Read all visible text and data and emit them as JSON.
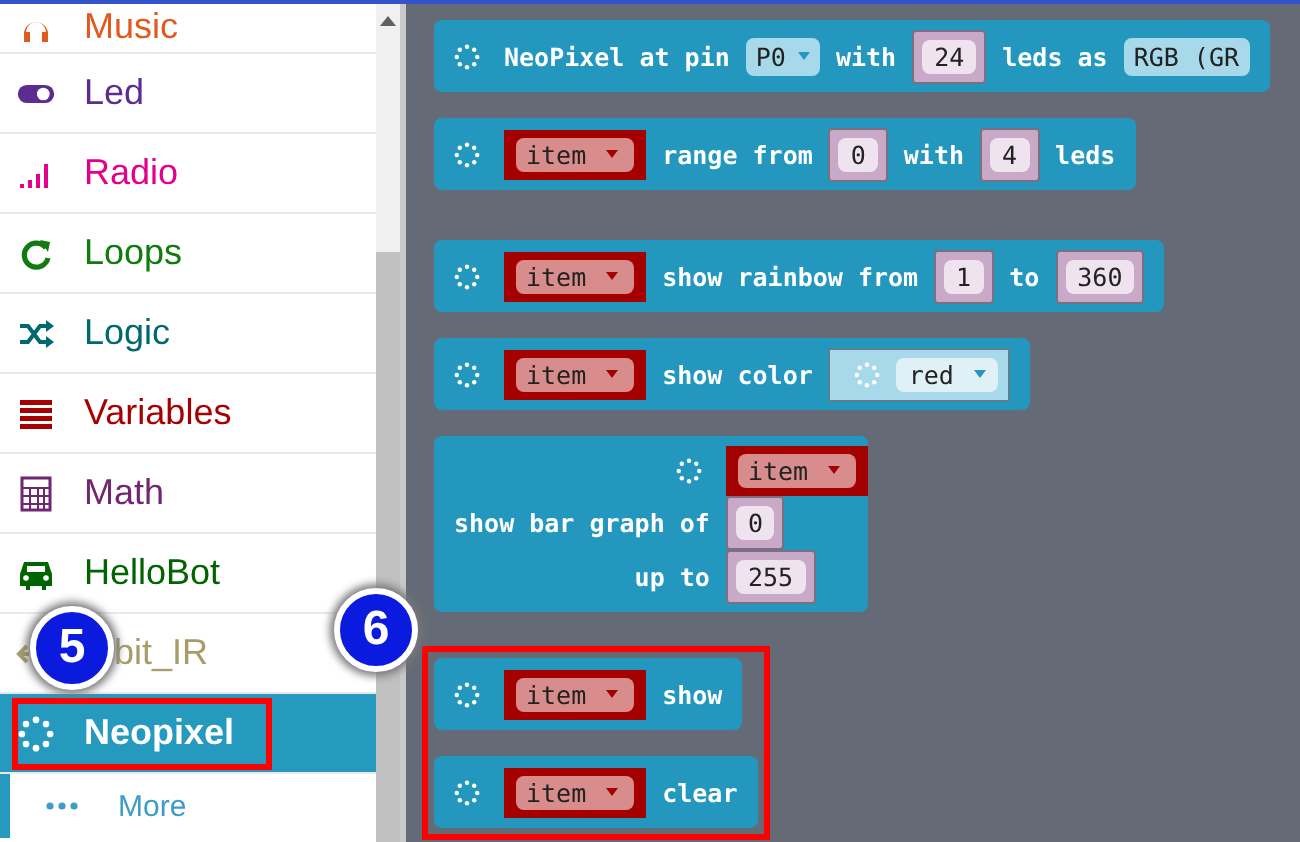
{
  "sidebar": {
    "items": [
      {
        "label": "Music",
        "kind": "music",
        "color": "#e05a1e",
        "selected": false,
        "highlighted": false
      },
      {
        "label": "Led",
        "kind": "toggle",
        "color": "#5c2d91",
        "selected": false,
        "highlighted": false
      },
      {
        "label": "Radio",
        "kind": "signal",
        "color": "#e3008c",
        "selected": false,
        "highlighted": false
      },
      {
        "label": "Loops",
        "kind": "loop",
        "color": "#107c10",
        "selected": false,
        "highlighted": false
      },
      {
        "label": "Logic",
        "kind": "shuffle",
        "color": "#006970",
        "selected": false,
        "highlighted": false
      },
      {
        "label": "Variables",
        "kind": "lines",
        "color": "#a80000",
        "selected": false,
        "highlighted": false
      },
      {
        "label": "Math",
        "kind": "calculator",
        "color": "#712672",
        "selected": false,
        "highlighted": false
      },
      {
        "label": "HelloBot",
        "kind": "car",
        "color": "#006400",
        "selected": false,
        "highlighted": false
      },
      {
        "label": "bit_IR",
        "kind": "ir",
        "color": "#a89d6a",
        "selected": false,
        "highlighted": false
      },
      {
        "label": "Neopixel",
        "kind": "dots",
        "color": "#2699bf",
        "selected": true,
        "highlighted": true
      }
    ],
    "more": {
      "label": "More"
    }
  },
  "workspace": {
    "sections": [
      {
        "highlighted": false,
        "blocks": [
          {
            "kind": "row",
            "parts": [
              {
                "kind": "icon"
              },
              {
                "kind": "text",
                "text": "NeoPixel at pin"
              },
              {
                "kind": "dropdown",
                "text": "P0"
              },
              {
                "kind": "text",
                "text": "with"
              },
              {
                "kind": "num",
                "text": "24"
              },
              {
                "kind": "text",
                "text": "leds as"
              },
              {
                "kind": "field",
                "text": "RGB (GR"
              }
            ]
          },
          {
            "kind": "row",
            "parts": [
              {
                "kind": "icon"
              },
              {
                "kind": "var",
                "text": "item"
              },
              {
                "kind": "text",
                "text": "range from"
              },
              {
                "kind": "num",
                "text": "0"
              },
              {
                "kind": "text",
                "text": "with"
              },
              {
                "kind": "num",
                "text": "4"
              },
              {
                "kind": "text",
                "text": "leds"
              }
            ]
          },
          {
            "kind": "row",
            "parts": [
              {
                "kind": "icon"
              },
              {
                "kind": "var",
                "text": "item"
              },
              {
                "kind": "text",
                "text": "show rainbow from"
              },
              {
                "kind": "num",
                "text": "1"
              },
              {
                "kind": "text",
                "text": "to"
              },
              {
                "kind": "num",
                "text": "360"
              }
            ]
          },
          {
            "kind": "row",
            "parts": [
              {
                "kind": "icon"
              },
              {
                "kind": "var",
                "text": "item"
              },
              {
                "kind": "text",
                "text": "show color"
              },
              {
                "kind": "color",
                "text": "red"
              }
            ]
          },
          {
            "kind": "stack",
            "rows": [
              {
                "parts": [
                  {
                    "kind": "icon"
                  }
                ],
                "input": {
                  "kind": "var",
                  "text": "item"
                }
              },
              {
                "parts": [
                  {
                    "kind": "text",
                    "text": "show bar graph of"
                  }
                ],
                "input": {
                  "kind": "num",
                  "text": "0"
                }
              },
              {
                "parts": [
                  {
                    "kind": "text",
                    "text": "up to"
                  }
                ],
                "input": {
                  "kind": "num",
                  "text": "255"
                }
              }
            ]
          }
        ]
      },
      {
        "highlighted": true,
        "blocks": [
          {
            "kind": "row",
            "parts": [
              {
                "kind": "icon"
              },
              {
                "kind": "var",
                "text": "item"
              },
              {
                "kind": "text",
                "text": "show"
              }
            ]
          },
          {
            "kind": "row",
            "parts": [
              {
                "kind": "icon"
              },
              {
                "kind": "var",
                "text": "item"
              },
              {
                "kind": "text",
                "text": "clear"
              }
            ]
          }
        ]
      }
    ]
  },
  "callouts": [
    {
      "text": "5"
    },
    {
      "text": "6"
    }
  ]
}
